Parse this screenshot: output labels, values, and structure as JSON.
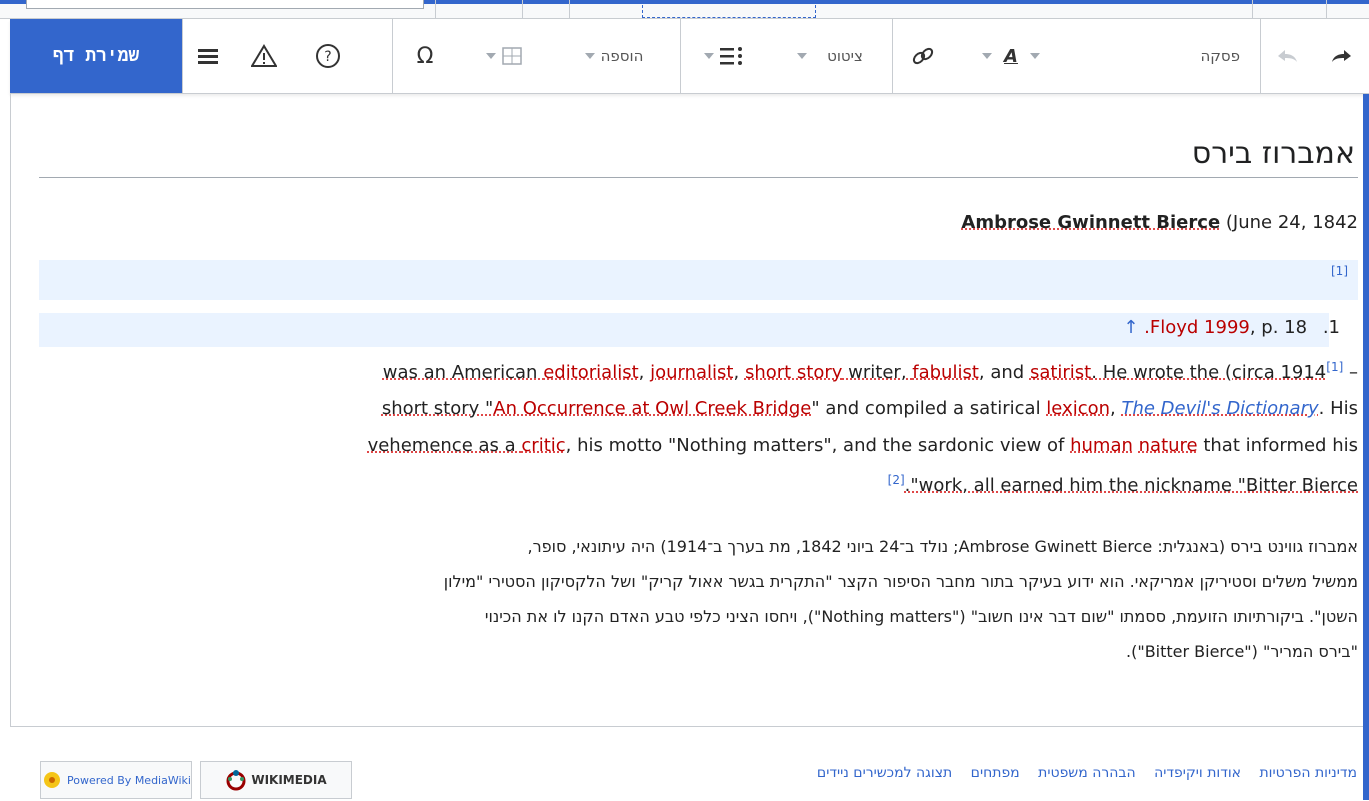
{
  "toolbar": {
    "save_label": "שמירת דף",
    "special_char_label": "Ω",
    "insert_label": "הוספה",
    "cite_label": "ציטוט",
    "paragraph_label": "פסקה"
  },
  "article": {
    "title": "אמברוז בירס",
    "lead_name": "Ambrose Gwinnett Bierce",
    "lead_date": "(June 24, 1842",
    "ref_marker": "[1]",
    "ref_num": ".1",
    "ref_text": ".Floyd 1999",
    "ref_page": ", p. 18",
    "ref_up": "↑",
    "en": {
      "l1_start": "was an American ",
      "l1_editorialist": "editorialist",
      "l1_sep1": ", ",
      "l1_journalist": "journalist",
      "l1_sep2": ", ",
      "l1_short_story": "short story",
      "l1_writer": " writer, ",
      "l1_fabulist": "fabulist",
      "l1_and": ", and ",
      "l1_satirist": "satirist",
      "l1_end": ". He wrote the (circa 1914",
      "l1_sup": "[1]",
      "l1_dash": " –",
      "l2_start": "short story \"",
      "l2_owl": "An Occurrence at Owl Creek Bridge",
      "l2_mid": "\" and compiled a satirical ",
      "l2_lexicon": "lexicon",
      "l2_comma": ", ",
      "l2_devil": "The Devil's Dictionary",
      "l2_end": ". His",
      "l3_start": "vehemence as a ",
      "l3_critic": "critic",
      "l3_mid": ", his motto \"Nothing matters\", and the sardonic view of ",
      "l3_human": "human",
      "l3_space": " ",
      "l3_nature": "nature",
      "l3_end": " that informed his",
      "l4_sup": "[2]",
      "l4_text": ".\"work, all earned him the nickname \"Bitter Bierce"
    },
    "he": {
      "l1": "אמברוז גווינט בירס (באנגלית: Ambrose Gwinett Bierce; נולד ב־24 ביוני 1842, מת בערך ב־1914) היה עיתונאי, סופר,",
      "l2": "ממשיל משלים וסטיריקן אמריקאי. הוא ידוע בעיקר בתור מחבר הסיפור הקצר \"התקרית בגשר אאול קריק\" ושל הלקסיקון הסטירי \"מילון",
      "l3": "השטן\". ביקורתיותו הזועמת, ססמתו \"שום דבר אינו חשוב\" (\"Nothing matters\"), ויחסו הציני כלפי טבע האדם הקנו לו את הכינוי",
      "l4": "\"בירס המריר\" (\"Bitter Bierce\")."
    }
  },
  "footer": {
    "links": [
      "מדיניות הפרטיות",
      "אודות ויקיפדיה",
      "הבהרה משפטית",
      "מפתחים",
      "תצוגה למכשירים ניידים"
    ],
    "wikimedia_label": "WIKIMEDIA",
    "mediawiki_label": "Powered By MediaWiki"
  },
  "colors": {
    "accent": "#3366cc",
    "redlink": "#ba0000"
  }
}
